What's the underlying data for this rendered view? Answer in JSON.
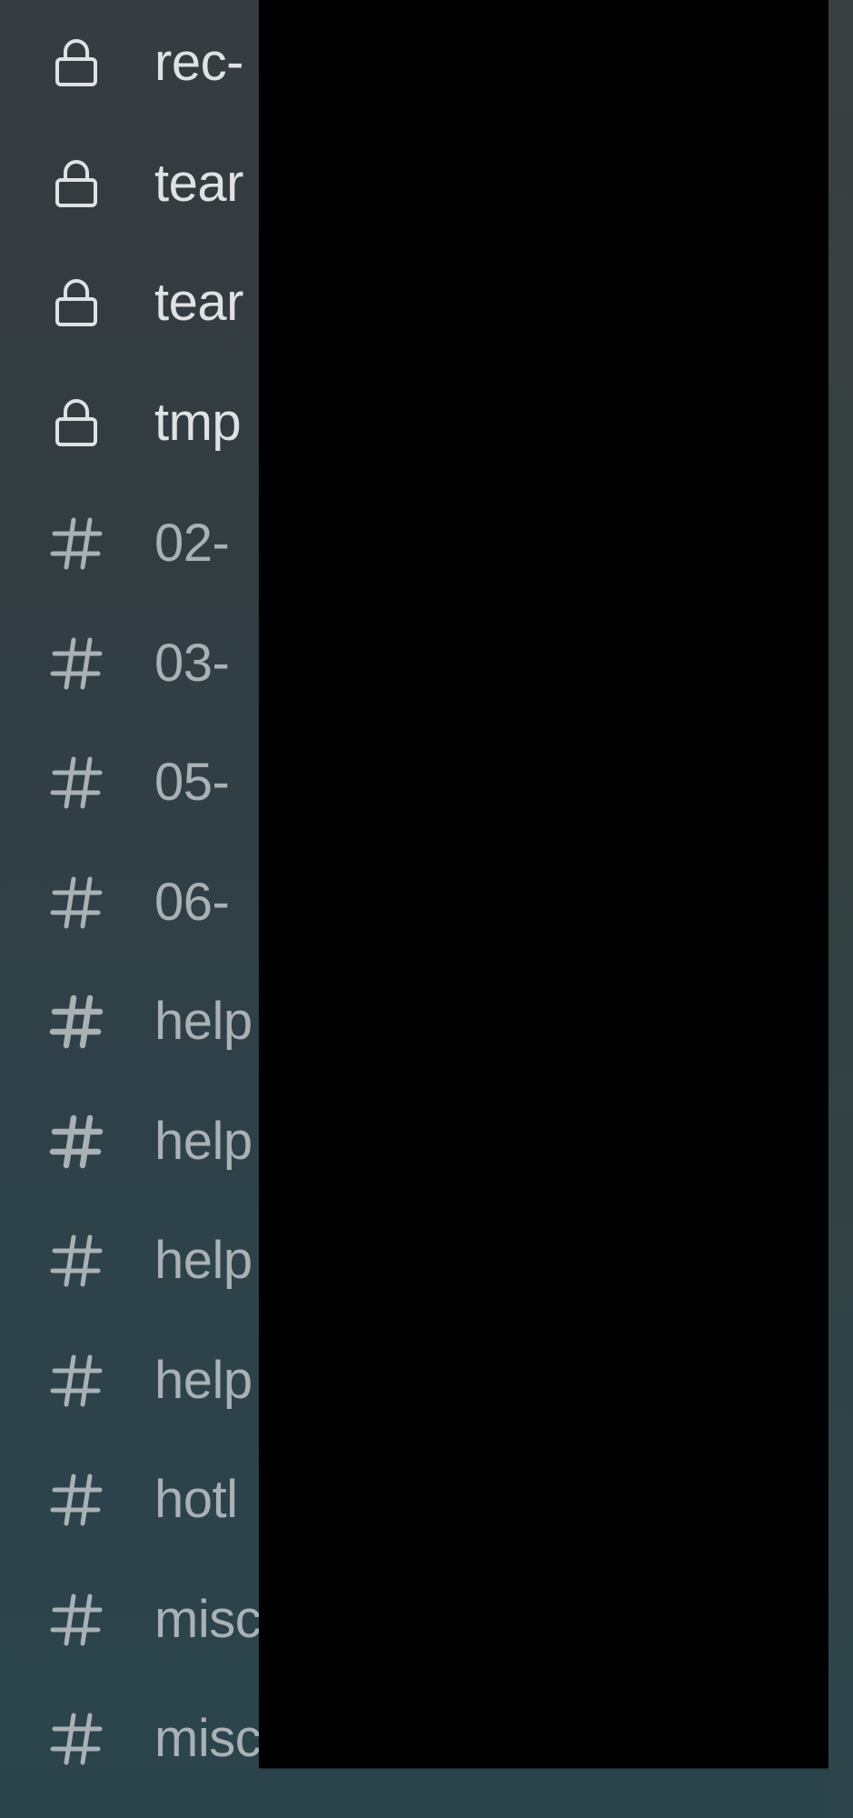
{
  "sidebar": {
    "channels": [
      {
        "name": "rec-",
        "type": "private",
        "icon": "lock-icon"
      },
      {
        "name": "tear",
        "type": "private",
        "icon": "lock-icon"
      },
      {
        "name": "tear",
        "type": "private",
        "icon": "lock-icon"
      },
      {
        "name": "tmp",
        "type": "private",
        "icon": "lock-icon"
      },
      {
        "name": "02-",
        "type": "public",
        "icon": "hash-icon"
      },
      {
        "name": "03-",
        "type": "public",
        "icon": "hash-icon"
      },
      {
        "name": "05-",
        "type": "public",
        "icon": "hash-icon"
      },
      {
        "name": "06-",
        "type": "public",
        "icon": "hash-icon"
      },
      {
        "name": "help",
        "type": "public",
        "icon": "hash-icon"
      },
      {
        "name": "help",
        "type": "public",
        "icon": "hash-icon"
      },
      {
        "name": "help",
        "type": "public",
        "icon": "hash-icon"
      },
      {
        "name": "help",
        "type": "public",
        "icon": "hash-icon"
      },
      {
        "name": "hotl",
        "type": "public",
        "icon": "hash-icon"
      },
      {
        "name": "misc",
        "type": "public",
        "icon": "hash-icon"
      },
      {
        "name": "misc",
        "type": "public",
        "icon": "hash-icon"
      }
    ]
  },
  "redaction": {
    "label": ""
  }
}
